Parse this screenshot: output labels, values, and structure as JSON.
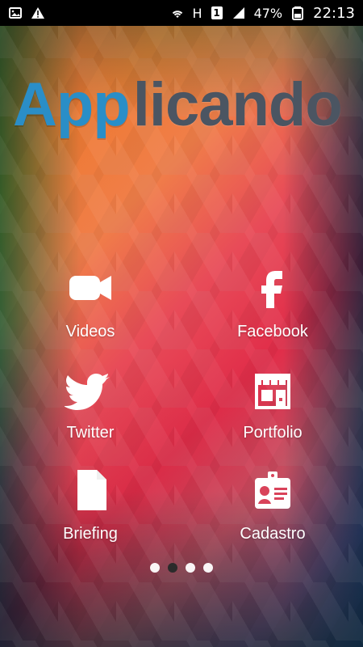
{
  "status_bar": {
    "battery": "47%",
    "time": "22:13",
    "sim_badge": "1",
    "network_h": "H"
  },
  "logo": {
    "part1": "App",
    "part2": "licando"
  },
  "menu": {
    "items": [
      {
        "label": "Videos",
        "icon": "video-camera-icon"
      },
      {
        "label": "Facebook",
        "icon": "facebook-icon"
      },
      {
        "label": "Twitter",
        "icon": "twitter-bird-icon"
      },
      {
        "label": "Portfolio",
        "icon": "storefront-icon"
      },
      {
        "label": "Briefing",
        "icon": "document-icon"
      },
      {
        "label": "Cadastro",
        "icon": "id-card-icon"
      }
    ]
  },
  "pager": {
    "total": 4,
    "active_index": 1
  }
}
